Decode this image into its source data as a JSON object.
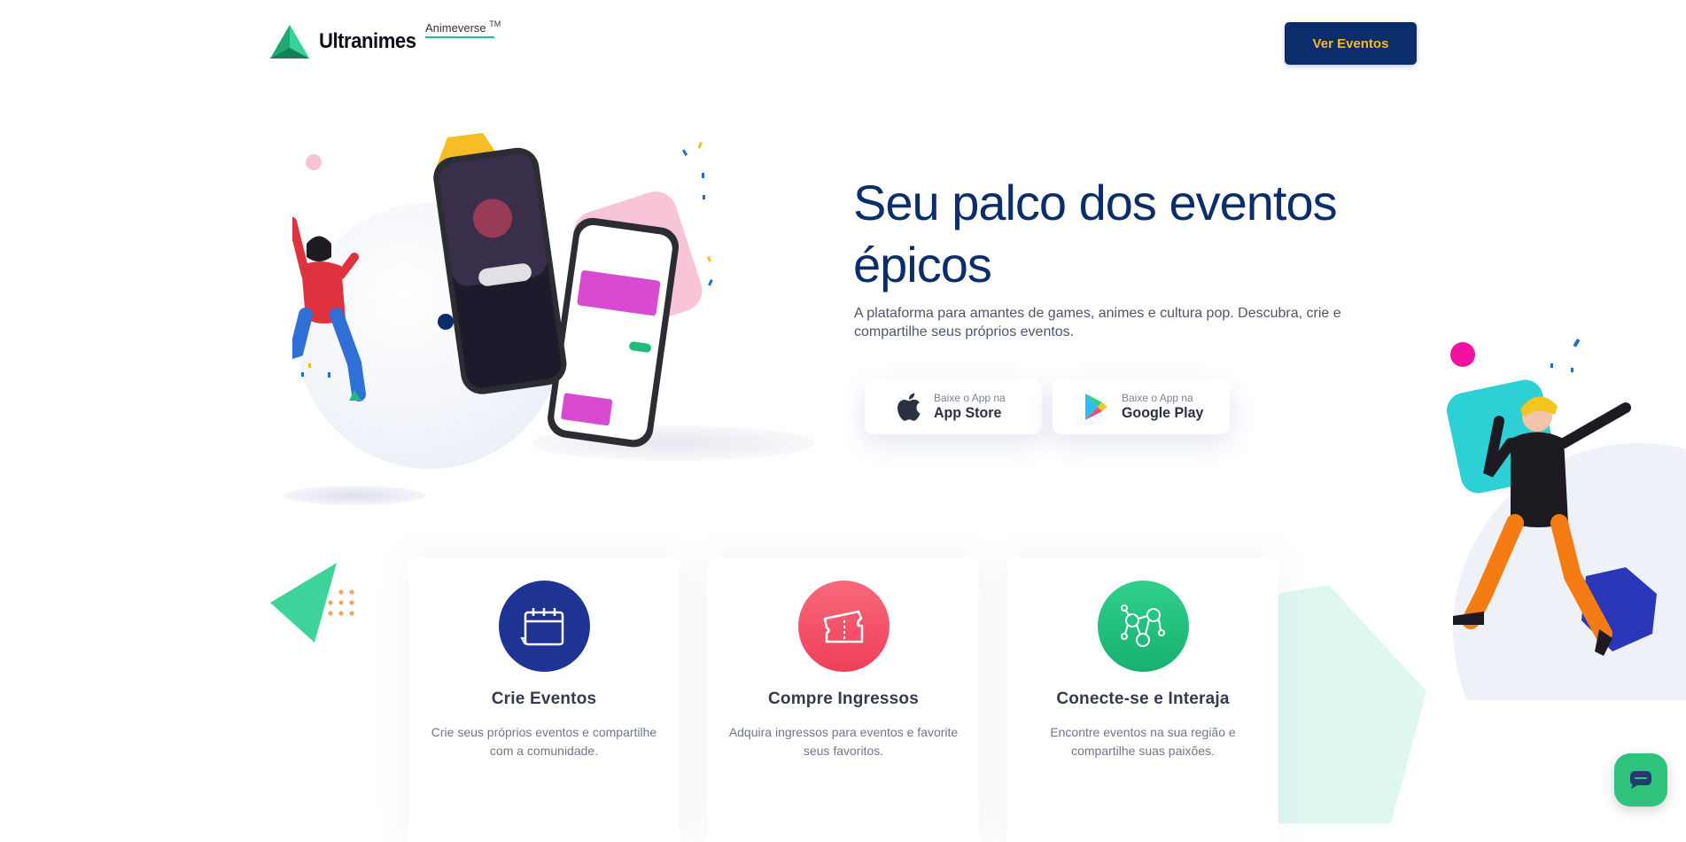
{
  "header": {
    "brand_name": "Ultranimes",
    "sub_brand": "Animeverse",
    "trademark": "TM",
    "cta_label": "Ver Eventos"
  },
  "hero": {
    "title": "Seu palco dos eventos épicos",
    "description": "A plataforma para amantes de games, animes e cultura pop. Descubra, crie e compartilhe seus próprios eventos.",
    "app_store": {
      "small": "Baixe o App na",
      "big": "App Store"
    },
    "google_play": {
      "small": "Baixe o App na",
      "big": "Google Play"
    }
  },
  "features": [
    {
      "title": "Crie Eventos",
      "text": "Crie seus próprios eventos e compartilhe com a comunidade.",
      "icon": "calendar-icon",
      "color": "#1f3392"
    },
    {
      "title": "Compre Ingressos",
      "text": "Adquira ingressos para eventos e favorite seus favoritos.",
      "icon": "ticket-icon",
      "color": "#f2506a"
    },
    {
      "title": "Conecte-se e Interaja",
      "text": "Encontre eventos na sua região e compartilhe suas paixões.",
      "icon": "network-icon",
      "color": "#1fbd7c"
    }
  ],
  "colors": {
    "primary": "#0b2d6b",
    "accent_yellow": "#f5b92b",
    "accent_green": "#23c483",
    "accent_red": "#f2506a"
  }
}
